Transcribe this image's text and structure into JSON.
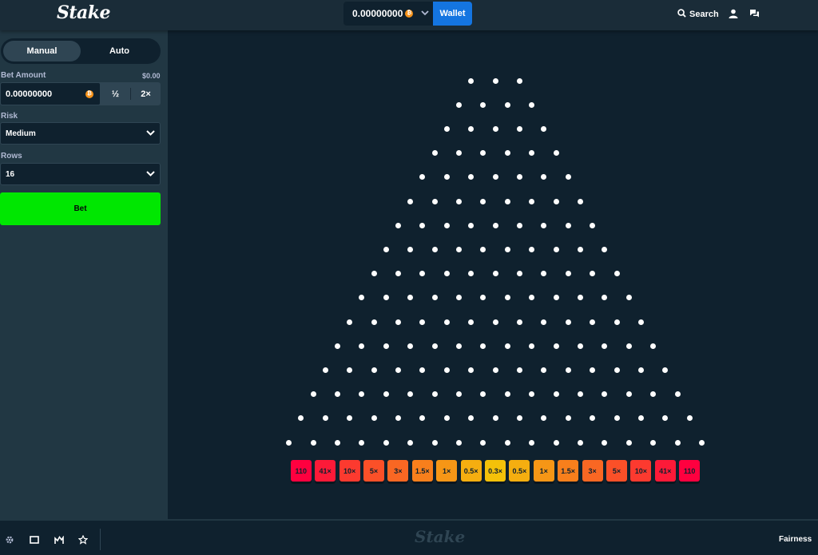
{
  "header": {
    "logo": "Stake",
    "balance": "0.00000000",
    "currency_icon": "bitcoin-icon",
    "wallet_label": "Wallet",
    "search_label": "Search"
  },
  "sidebar": {
    "tabs": [
      {
        "label": "Manual",
        "active": true
      },
      {
        "label": "Auto",
        "active": false
      }
    ],
    "bet_amount_label": "Bet Amount",
    "bet_amount_usd": "$0.00",
    "bet_amount_value": "0.00000000",
    "half_label": "½",
    "double_label": "2×",
    "risk_label": "Risk",
    "risk_value": "Medium",
    "rows_label": "Rows",
    "rows_value": "16",
    "bet_button_label": "Bet"
  },
  "board": {
    "rows": 16,
    "first_row_pegs": 3,
    "multipliers": [
      "110",
      "41×",
      "10×",
      "5×",
      "3×",
      "1.5×",
      "1×",
      "0.5×",
      "0.3×",
      "0.5×",
      "1×",
      "1.5×",
      "3×",
      "5×",
      "10×",
      "41×",
      "110"
    ],
    "slot_colors": [
      "#ff003f",
      "#fd1a38",
      "#fc3a2f",
      "#fb5028",
      "#f96723",
      "#f87f1c",
      "#f69616",
      "#f5ae10",
      "#f4c109",
      "#f5ae10",
      "#f69616",
      "#f87f1c",
      "#f96723",
      "#fb5028",
      "#fc3a2f",
      "#fd1a38",
      "#ff003f"
    ]
  },
  "footer": {
    "logo": "Stake",
    "fairness_label": "Fairness",
    "icons": [
      "settings-icon",
      "theatre-mode-icon",
      "live-stats-icon",
      "favorite-icon"
    ]
  },
  "colors": {
    "background": "#0f212e",
    "panel": "#213743",
    "accent_green": "#00e701",
    "wallet_blue": "#1475e1"
  }
}
